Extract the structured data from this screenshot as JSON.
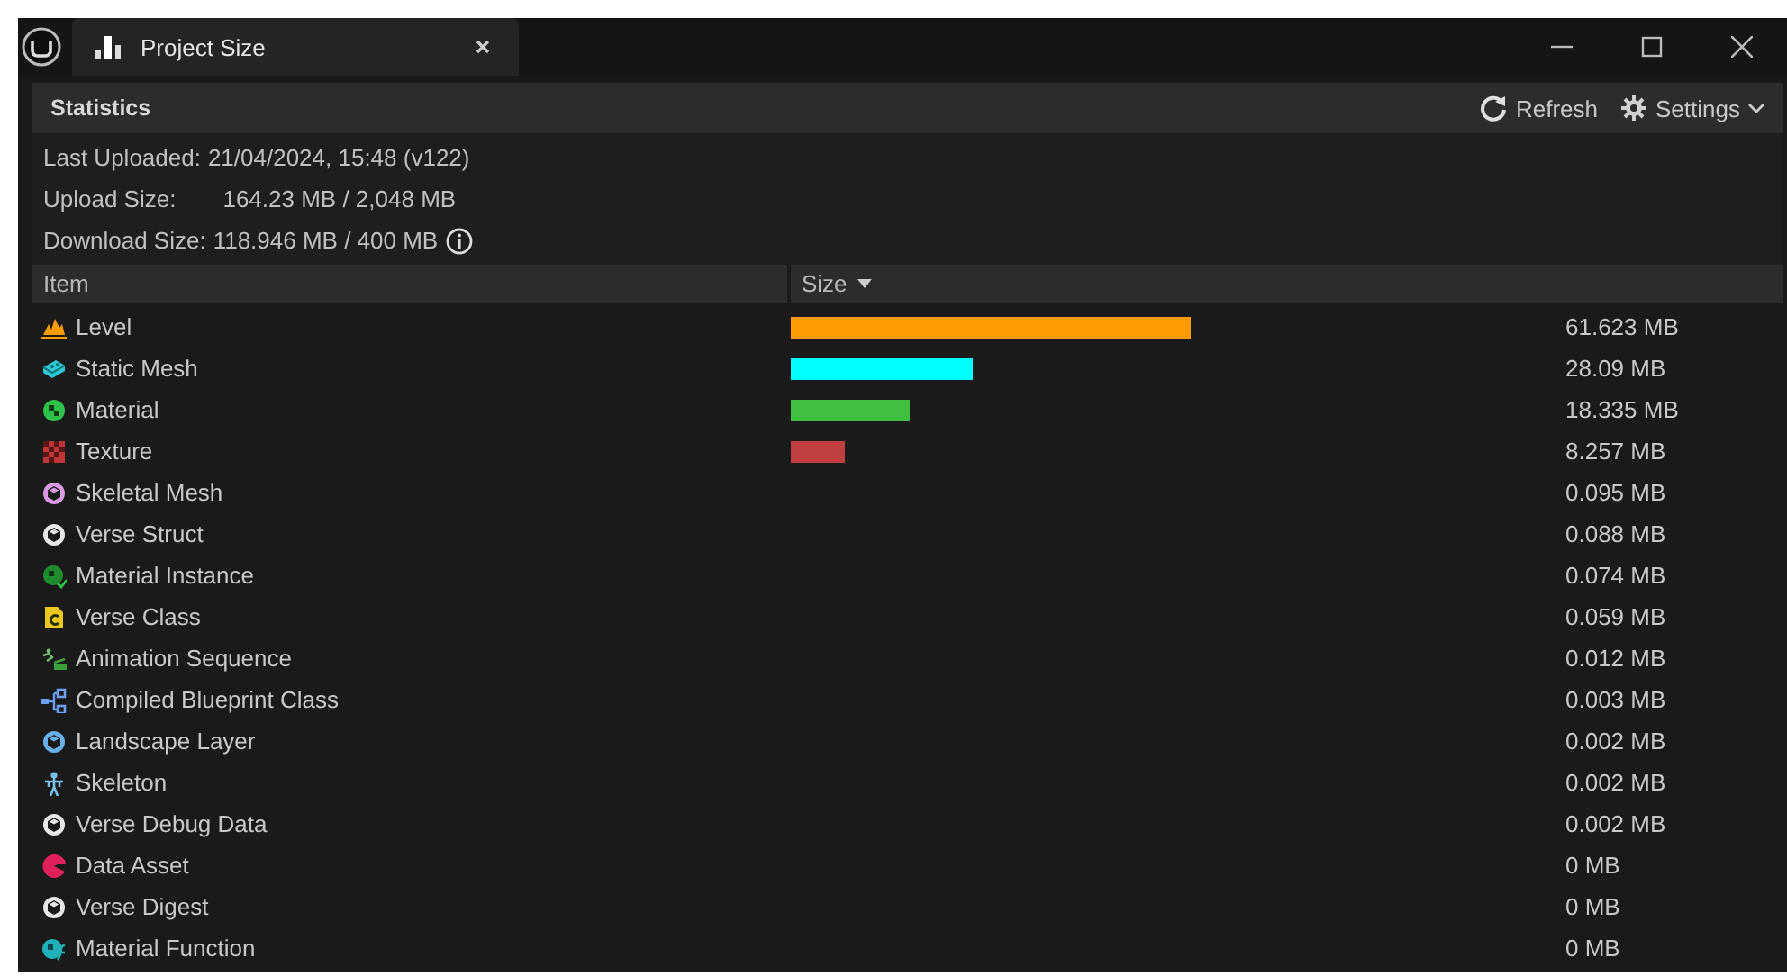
{
  "window": {
    "title": "Project Size"
  },
  "toolbar": {
    "title": "Statistics",
    "buttons": [
      {
        "kind": "refresh",
        "label": "Refresh"
      },
      {
        "kind": "settings",
        "label": "Settings"
      }
    ]
  },
  "info": [
    {
      "label": "Last Uploaded:",
      "value": "21/04/2024, 15:48 (v122)"
    },
    {
      "label": "Upload Size:",
      "value": "164.23 MB / 2,048 MB"
    },
    {
      "label": "Download Size:",
      "value": "118.946 MB / 400 MB",
      "info_icon": true
    }
  ],
  "table": {
    "columns": [
      {
        "label": "Item",
        "sorted": false
      },
      {
        "label": "Size",
        "sorted": true
      }
    ],
    "rows": [
      {
        "kind": "level",
        "name": "Level",
        "size": "61.623 MB",
        "color": "#ff9d00"
      },
      {
        "kind": "static-mesh",
        "name": "Static Mesh",
        "size": "28.09 MB",
        "color": "#00ffff"
      },
      {
        "kind": "material",
        "name": "Material",
        "size": "18.335 MB",
        "color": "#40c040"
      },
      {
        "kind": "texture",
        "name": "Texture",
        "size": "8.257 MB",
        "color": "#c04040"
      },
      {
        "kind": "skeletal-mesh",
        "name": "Skeletal Mesh",
        "size": "0.095 MB"
      },
      {
        "kind": "verse",
        "name": "Verse Struct",
        "size": "0.088 MB"
      },
      {
        "kind": "material-instance",
        "name": "Material Instance",
        "size": "0.074 MB"
      },
      {
        "kind": "verse-class",
        "name": "Verse Class",
        "size": "0.059 MB"
      },
      {
        "kind": "animation",
        "name": "Animation Sequence",
        "size": "0.012 MB"
      },
      {
        "kind": "blueprint",
        "name": "Compiled Blueprint Class",
        "size": "0.003 MB"
      },
      {
        "kind": "landscape-layer",
        "name": "Landscape Layer",
        "size": "0.002 MB"
      },
      {
        "kind": "skeleton",
        "name": "Skeleton",
        "size": "0.002 MB"
      },
      {
        "kind": "verse",
        "name": "Verse Debug Data",
        "size": "0.002 MB"
      },
      {
        "kind": "data-asset",
        "name": "Data Asset",
        "size": "0 MB"
      },
      {
        "kind": "verse",
        "name": "Verse Digest",
        "size": "0 MB"
      },
      {
        "kind": "material-function",
        "name": "Material Function",
        "size": "0 MB"
      }
    ]
  }
}
